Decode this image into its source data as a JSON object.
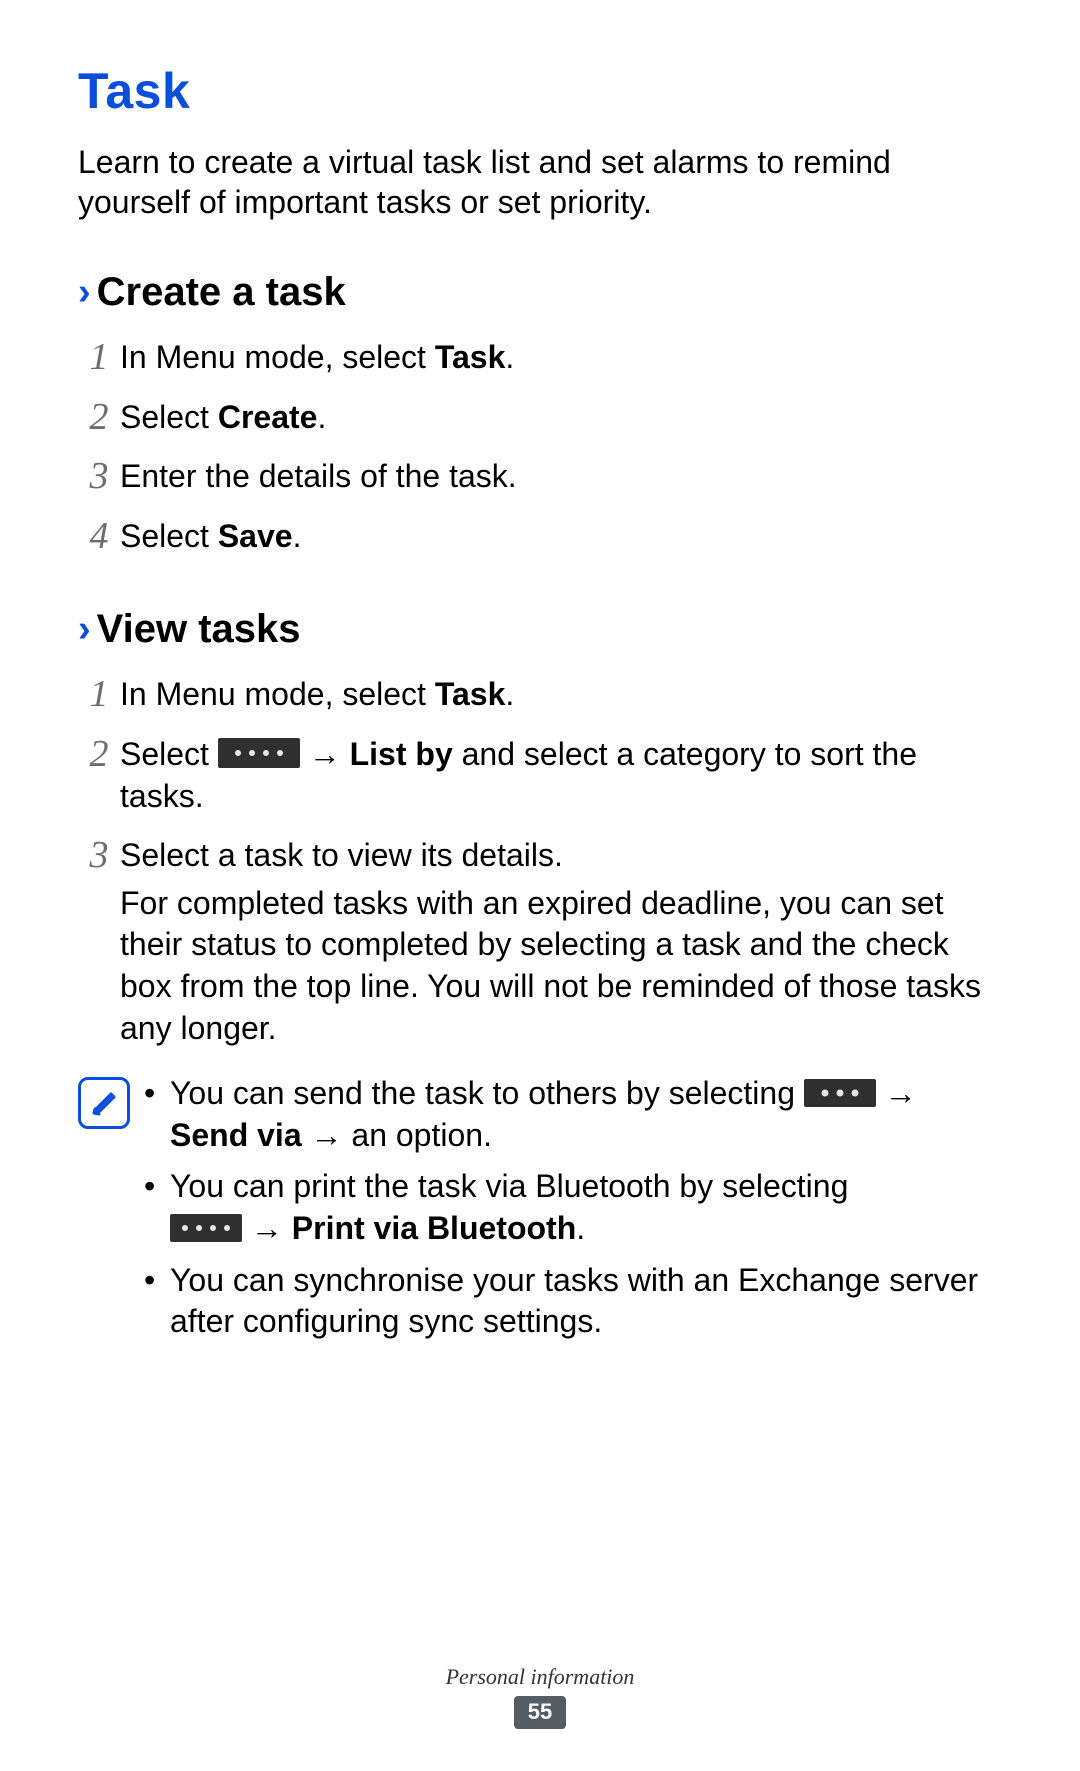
{
  "title": "Task",
  "intro": "Learn to create a virtual task list and set alarms to remind yourself of important tasks or set priority.",
  "sections": {
    "create": {
      "heading": "Create a task",
      "steps": {
        "s1_pre": "In Menu mode, select ",
        "s1_bold": "Task",
        "s1_post": ".",
        "s2_pre": "Select ",
        "s2_bold": "Create",
        "s2_post": ".",
        "s3": "Enter the details of the task.",
        "s4_pre": "Select ",
        "s4_bold": "Save",
        "s4_post": "."
      }
    },
    "view": {
      "heading": "View tasks",
      "steps": {
        "s1_pre": "In Menu mode, select ",
        "s1_bold": "Task",
        "s1_post": ".",
        "s2_pre": "Select ",
        "s2_arrow": " → ",
        "s2_bold": "List by",
        "s2_post": " and select a category to sort the tasks.",
        "s3_line1": "Select a task to view its details.",
        "s3_detail": "For completed tasks with an expired deadline, you can set their status to completed by selecting a task and the check box from the top line. You will not be reminded of those tasks any longer."
      },
      "notes": {
        "n1_pre": "You can send the task to others by selecting ",
        "n1_arrow1": " → ",
        "n1_bold": "Send via",
        "n1_arrow2": " → ",
        "n1_post": "an option.",
        "n2_pre": "You can print the task via Bluetooth by selecting ",
        "n2_arrow": " → ",
        "n2_bold": "Print via Bluetooth",
        "n2_post": ".",
        "n3": "You can synchronise your tasks with an Exchange server after configuring sync settings."
      }
    }
  },
  "footer": {
    "label": "Personal information",
    "page": "55"
  },
  "nums": {
    "1": "1",
    "2": "2",
    "3": "3",
    "4": "4"
  },
  "bullet": "•"
}
